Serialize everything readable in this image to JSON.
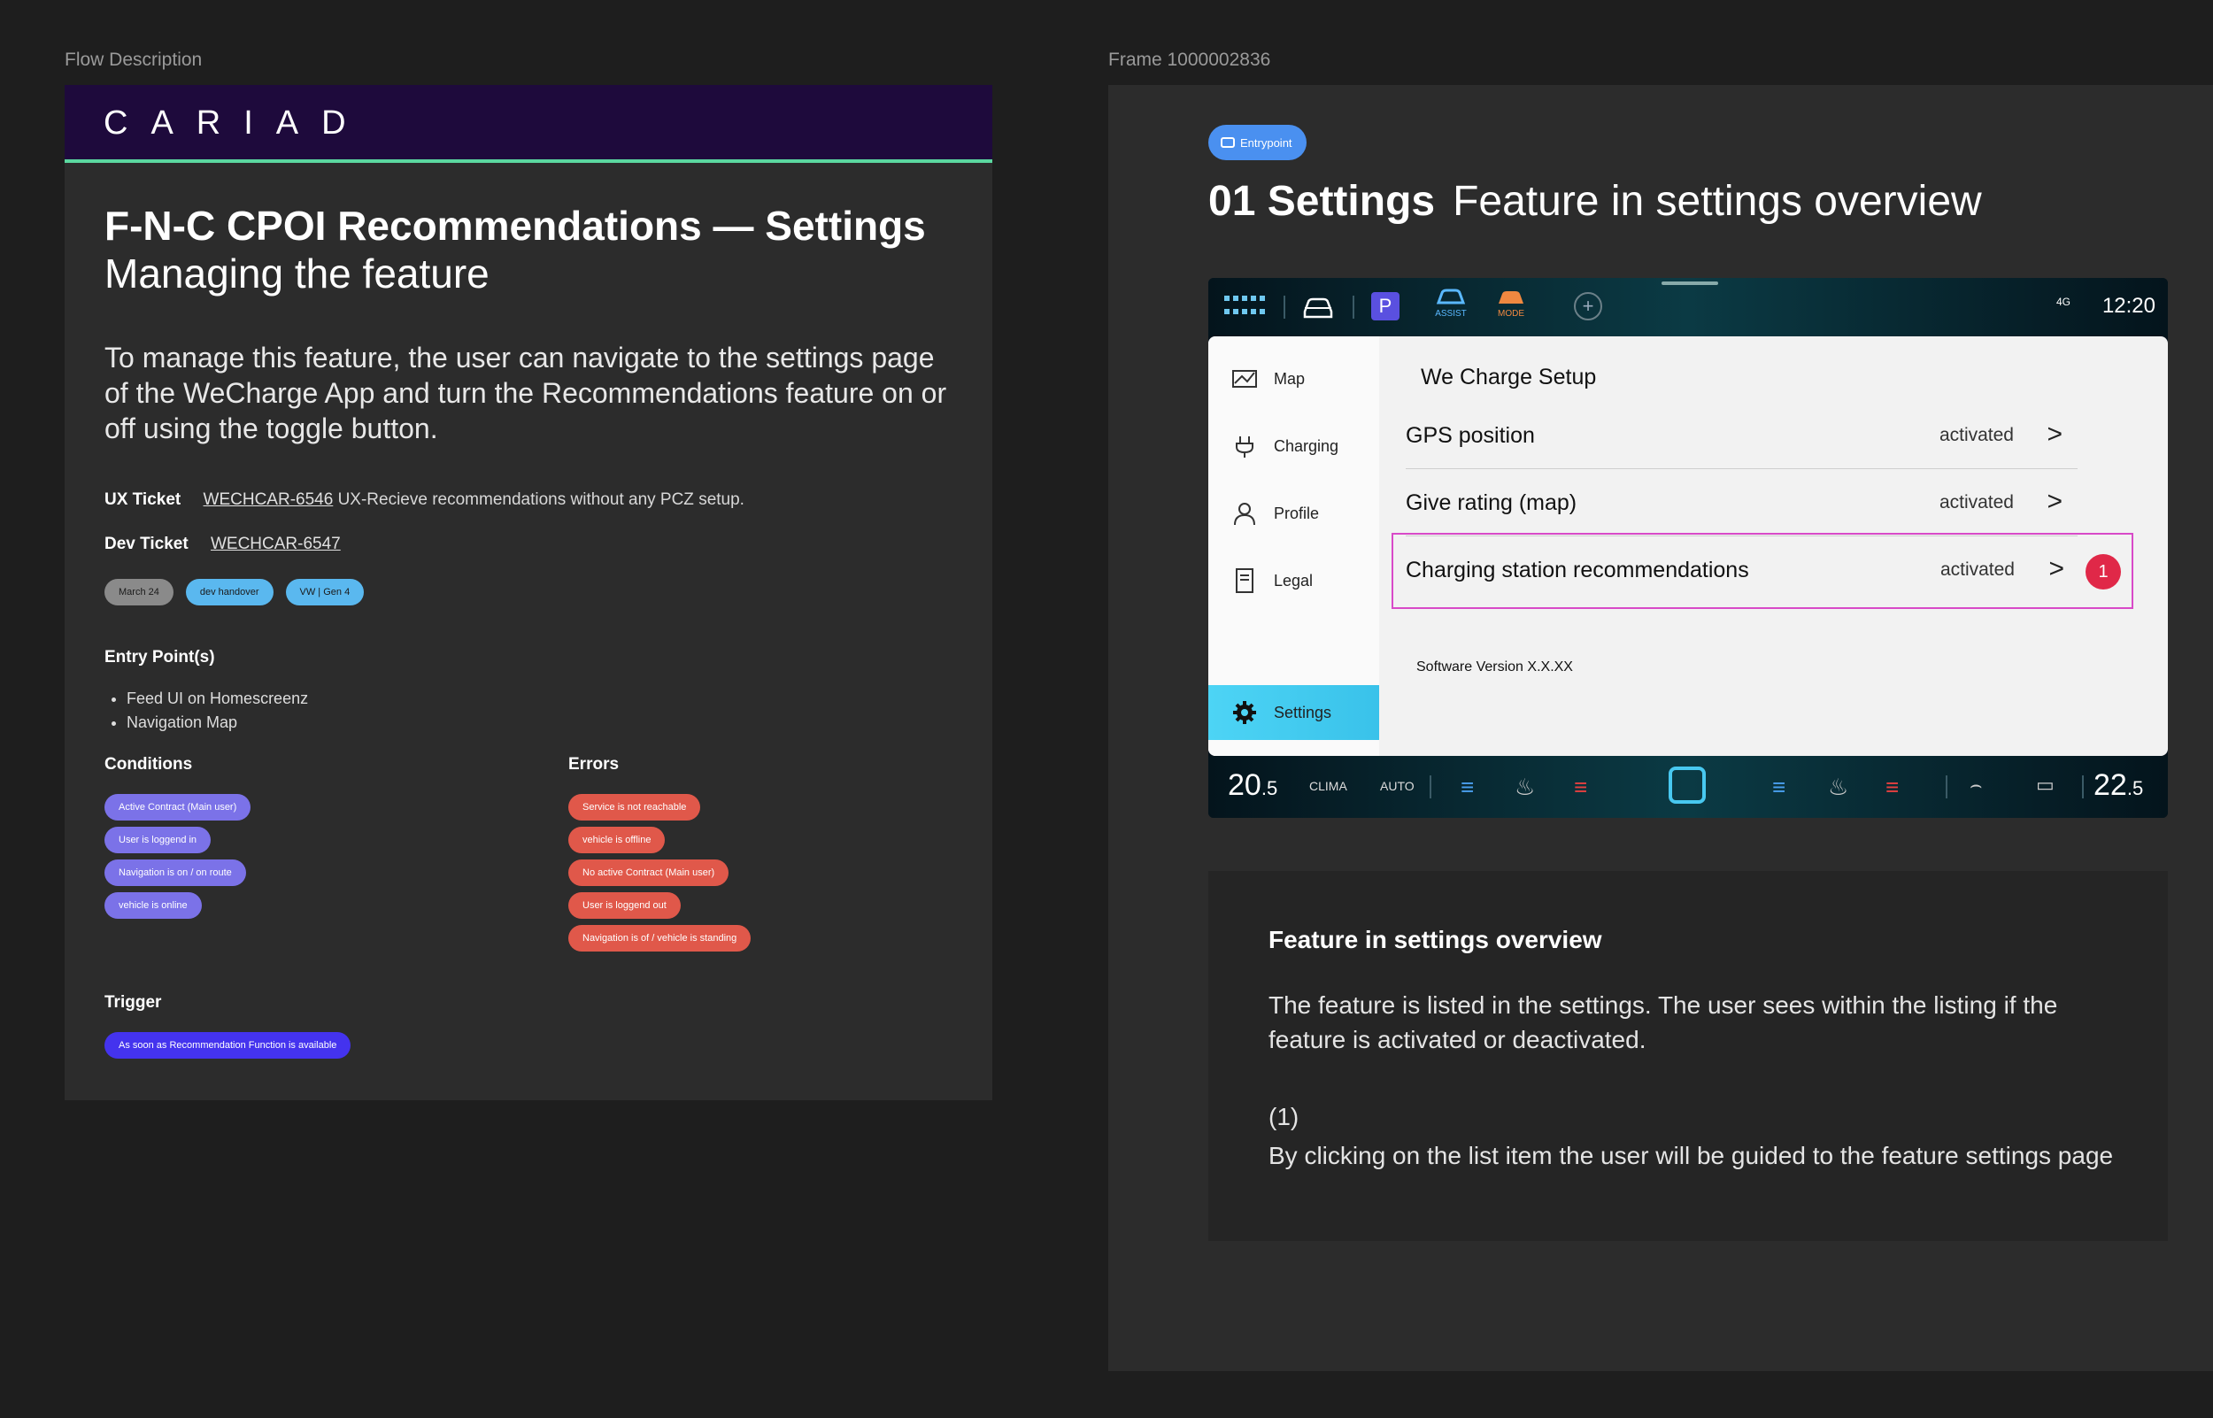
{
  "left_frame_label": "Flow Description",
  "right_frame_label": "Frame 1000002836",
  "brand": "CARIAD",
  "title": "F-N-C CPOI Recommendations — Settings",
  "subtitle": "Managing the feature",
  "intro": "To manage this feature, the user can navigate to the settings page of the WeCharge App and turn the Recommendations feature on or off using the toggle button.",
  "ux_ticket": {
    "label": "UX Ticket",
    "id": "WECHCAR-6546",
    "text": "UX-Recieve recommendations without any PCZ setup."
  },
  "dev_ticket": {
    "label": "Dev Ticket",
    "id": "WECHCAR-6547"
  },
  "tags": [
    {
      "label": "March 24",
      "color": "#8a8a8a"
    },
    {
      "label": "dev handover",
      "color": "#5ab8ef"
    },
    {
      "label": "VW | Gen 4",
      "color": "#5ab8ef"
    }
  ],
  "entry_points": {
    "heading": "Entry Point(s)",
    "items": [
      "Feed UI on Homescreenz",
      "Navigation Map"
    ]
  },
  "conditions": {
    "heading": "Conditions",
    "items": [
      "Active Contract (Main user)",
      "User is loggend in",
      "Navigation is on / on route",
      "vehicle is online"
    ]
  },
  "errors": {
    "heading": "Errors",
    "items": [
      "Service is not reachable",
      "vehicle is  offline",
      "No active Contract (Main user)",
      "User is loggend out",
      "Navigation is of / vehicle is standing"
    ]
  },
  "trigger": {
    "heading": "Trigger",
    "items": [
      "As soon as Recommendation Function is available"
    ]
  },
  "entry_badge": "Entrypoint",
  "frame_title": {
    "number": "01 Settings",
    "text": "Feature in settings overview"
  },
  "screen": {
    "topbar": {
      "assist": "ASSIST",
      "mode": "MODE",
      "parking": "P",
      "network": "4G",
      "clock": "12:20"
    },
    "nav": [
      "Map",
      "Charging",
      "Profile",
      "Legal"
    ],
    "nav_active": "Settings",
    "panel_title": "We Charge Setup",
    "rows": [
      {
        "label": "GPS position",
        "value": "activated"
      },
      {
        "label": "Give rating (map)",
        "value": "activated"
      },
      {
        "label": "Charging station recommendations",
        "value": "activated"
      }
    ],
    "marker": "1",
    "software_version": "Software Version X.X.XX",
    "bottombar": {
      "temp_left_main": "20",
      "temp_left_dec": ".5",
      "clima": "CLIMA",
      "auto": "AUTO",
      "temp_right_main": "22",
      "temp_right_dec": ".5"
    }
  },
  "description": {
    "title": "Feature in settings overview",
    "body": "The feature is listed in the settings. The user sees within the listing if the feature is activated or deactivated.",
    "number": "(1)",
    "click": "By clicking on the list item the user will be guided to the feature settings page"
  }
}
